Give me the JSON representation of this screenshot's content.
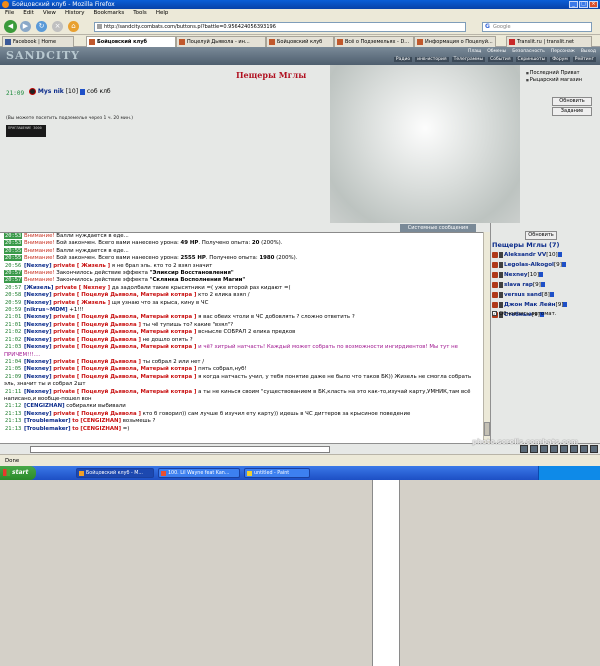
{
  "window": {
    "title": "Бойцовский клуб - Mozilla Firefox",
    "min": "_",
    "max": "□",
    "close": "×"
  },
  "menu": [
    "File",
    "Edit",
    "View",
    "History",
    "Bookmarks",
    "Tools",
    "Help"
  ],
  "nav": {
    "url": "http://sandcity.combats.com/buttons.pl?battle=0.956424056393196",
    "search_placeholder": "Google"
  },
  "tabs": [
    {
      "label": "Facebook | Home"
    },
    {
      "label": "Бойцовский клуб"
    },
    {
      "label": "Поцелуй Дьявола - ин..."
    },
    {
      "label": "Бойцовский клуб"
    },
    {
      "label": "Всё о Подземельях - D..."
    },
    {
      "label": "Информация о Поцелуй..."
    },
    {
      "label": "Translit.ru | translit.net"
    }
  ],
  "site": {
    "logo": "SANDCITY",
    "nav_top": [
      "Плащ",
      "Обмены",
      "Безопасность",
      "Персонаж",
      "Выход"
    ],
    "nav_bottom": [
      "Радио",
      "инв-история",
      "Телеграммы",
      "События",
      "Скриншоты",
      "Форум",
      "Рейтинг"
    ]
  },
  "location": {
    "title": "Пещеры Мглы",
    "time": "21:09",
    "user": "Mys nik",
    "level": "[10]",
    "status": "соб клб",
    "note": "(Вы можете посетить подземелье через 1 ч. 20 мин.)",
    "counter": "ПРИГЛАШЕНИЕ 3000"
  },
  "right_links": [
    "Последний Приват",
    "Рыцарский магазин"
  ],
  "buttons": {
    "refresh": "Обновить",
    "tasks": "Задание",
    "panel_refresh": "Обновить"
  },
  "chat_tabs": {
    "chat": "Чат",
    "system": "Системные сообщения"
  },
  "chat": [
    {
      "time": "20:53",
      "warn": "Внимание!",
      "text": " Валли нуждается в еде..."
    },
    {
      "time": "20:53",
      "warn": "Внимание!",
      "text": " Бой закончен. Всего вами нанесено урона: ",
      "bold1": "49 HP",
      "text2": ". Получено опыта: ",
      "bold2": "20",
      "text3": " (200%)."
    },
    {
      "time": "20:55",
      "warn": "Внимание!",
      "text": " Валли нуждается в еде..."
    },
    {
      "time": "20:55",
      "warn": "Внимание!",
      "text": " Бой закончен. Всего вами нанесено урона: ",
      "bold1": "2555 HP",
      "text2": ". Получено опыта: ",
      "bold2": "1980",
      "text3": " (200%)."
    },
    {
      "time": "20:56",
      "nick": "[Nexney]",
      "priv": "private [ Жизель ]",
      "text": " я не брал эль. кто то 2 взял значит"
    },
    {
      "time": "20:57",
      "warn": "Внимание!",
      "text": " Закончилось действие эффекта ",
      "bold1": "\"Эликсир Восстановления\""
    },
    {
      "time": "20:57",
      "warn": "Внимание!",
      "text": " Закончилось действие эффекта ",
      "bold1": "\"Склянка Восполнения Магии\""
    },
    {
      "time": "20:57",
      "nick": "[Жизель]",
      "priv": "private [ Nexney ]",
      "text": " да задолбали такие крысятники =( уже второй раз кидают =("
    },
    {
      "time": "20:58",
      "nick": "[Nexney]",
      "priv": "private [ Поцелуй Дьявола, Матерый котяра ]",
      "text": " кто 2 елика взял /"
    },
    {
      "time": "20:59",
      "nick": "[Nexney]",
      "priv": "private [ Жизель ]",
      "text": " щя узнаю что за крыса, кину в ЧС"
    },
    {
      "time": "20:59",
      "nick": "[nikrus~MDM]",
      "text": " +1!!!"
    },
    {
      "time": "21:01",
      "nick": "[Nexney]",
      "priv": "private [ Поцелуй Дьявола, Матерый котяра ]",
      "text": " я вас обеих чтоли в ЧС добовлять ? сложно ответить ?"
    },
    {
      "time": "21:01",
      "nick": "[Nexney]",
      "priv": "private [ Поцелуй Дьявола ]",
      "text": " ты чё тупишь то? какие \"взял\"?"
    },
    {
      "time": "21:02",
      "nick": "[Nexney]",
      "priv": "private [ Поцелуй Дьявола, Матерый котяра ]",
      "text": " вснысле СОБРАЛ 2 елика предков"
    },
    {
      "time": "21:02",
      "nick": "[Nexney]",
      "priv": "private [ Поцелуй Дьявола ]",
      "text": " не дошло опять ?"
    },
    {
      "time": "21:03",
      "nick": "[Nexney]",
      "priv": "private [ Поцелуй Дьявола, Матерый котяра ]",
      "purple": " и чё? хитрый натчасть! Каждый может собрать по возможности ингирдиентов! Мы тут не ПРИЧЕМ!!!....",
      "wrap": true
    },
    {
      "time": "21:04",
      "nick": "[Nexney]",
      "priv": "private [ Поцелуй Дьявола ]",
      "text": " ты собрал 2 или нет /"
    },
    {
      "time": "21:05",
      "nick": "[Nexney]",
      "priv": "private [ Поцелуй Дьявола, Матерый котяра ]",
      "text": " пять собрал,нуб!"
    },
    {
      "time": "21:09",
      "nick": "[Nexney]",
      "priv": "private [ Поцелуй Дьявола, Матерый котяра ]",
      "text": " я когда натчасть учил, у тебя понятие даже не было что таков БК)) Жизель не смогла собрать эль, значит ты и собрал 2шт",
      "wrap": true
    },
    {
      "time": "21:11",
      "nick": "[Nexney]",
      "priv": "private [ Поцелуй Дьявола, Матерый котяра ]",
      "text": " а ты не кинься своим \"существованием в БК,класть на это как-то,изучай карту,УМНИК,там всё написано,и вообще-пошел вон",
      "wrap": true
    },
    {
      "time": "21:12",
      "nick": "[CENGIZHAN]",
      "text": " собиралки выбивали"
    },
    {
      "time": "21:13",
      "nick": "[Nexney]",
      "priv": "private [ Поцелуй Дьявола ]",
      "text": " кто б говорил)) сам лучше б изучил ету карту)) идешь в ЧС дигтеров за крысиное поведение"
    },
    {
      "time": "21:13",
      "nick": "[Troublemaker]",
      "pm": " to [CENGIZHAN]",
      "text": " возьмешь ?"
    },
    {
      "time": "21:13",
      "nick": "[Troublemaker]",
      "pm": " to [CENGIZHAN]",
      "text": " =)"
    }
  ],
  "room": {
    "title": "Пещеры Мглы (7)",
    "users": [
      {
        "name": "Aleksandr VV",
        "level": "[10]"
      },
      {
        "name": "Legolas-Alkogol",
        "level": "[9]"
      },
      {
        "name": "Nexney",
        "level": "[10]"
      },
      {
        "name": "slava rap",
        "level": "[9]"
      },
      {
        "name": "versus sand",
        "level": "[8]"
      },
      {
        "name": "Джон Мак Лейн",
        "level": "[9]"
      },
      {
        "name": "Стебный",
        "level": "[9]"
      }
    ],
    "auto_update": "Обновлять автомат."
  },
  "status": "Done",
  "taskbar": {
    "start": "start",
    "tasks": [
      {
        "label": "Бойцовский клуб - M..."
      },
      {
        "label": "100. Lil Wayne feat Kan..."
      },
      {
        "label": "untitled - Paint"
      }
    ]
  },
  "watermark": "photo.scrolls.combats.com"
}
